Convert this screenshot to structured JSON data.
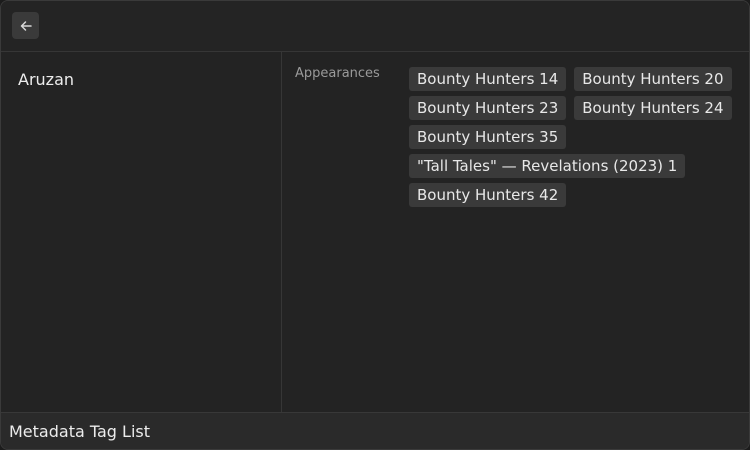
{
  "header": {
    "back_icon": "arrow-left-icon"
  },
  "sidebar": {
    "selected_item": "Aruzan"
  },
  "details": {
    "field_label": "Appearances",
    "tags": [
      "Bounty Hunters 14",
      "Bounty Hunters 20",
      "Bounty Hunters 23",
      "Bounty Hunters 24",
      "Bounty Hunters 35",
      "\"Tall Tales\" — Revelations (2023) 1",
      "Bounty Hunters 42"
    ]
  },
  "footer": {
    "title": "Metadata Tag List"
  }
}
